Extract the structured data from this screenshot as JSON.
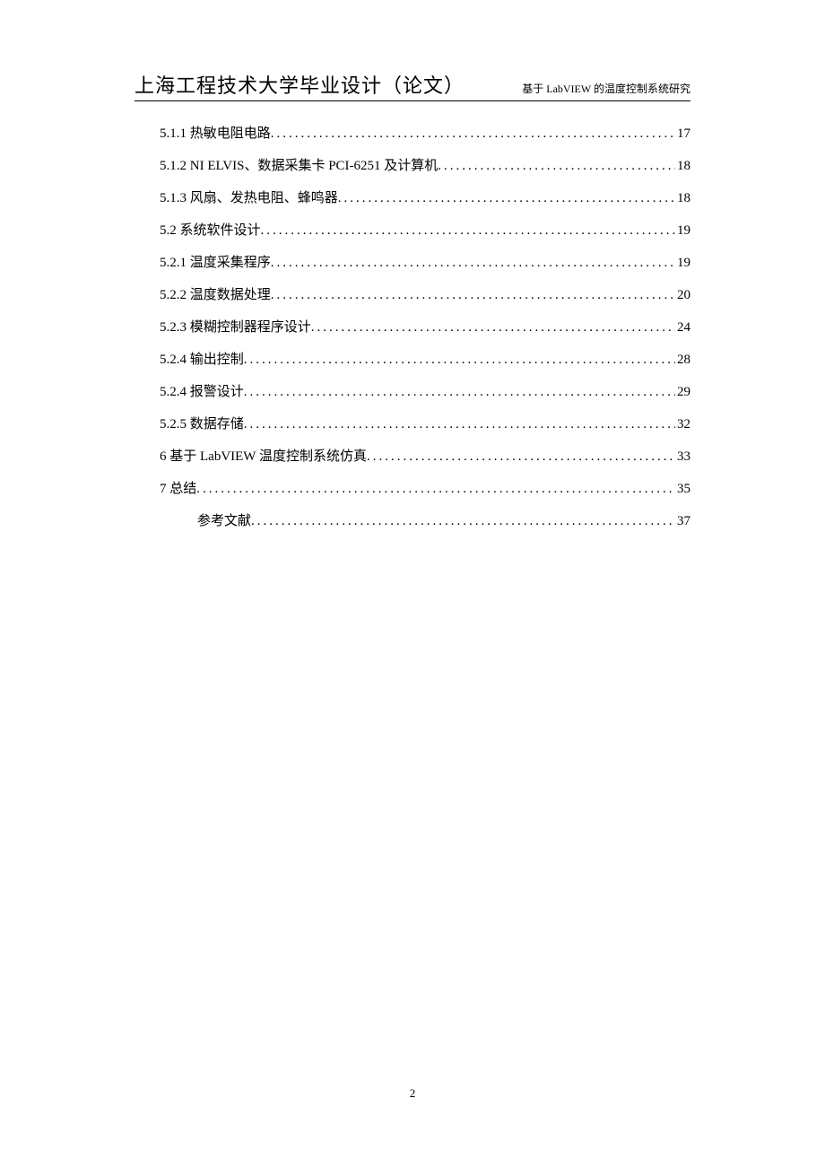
{
  "header": {
    "title": "上海工程技术大学毕业设计（论文）",
    "subtitle": "基于 LabVIEW 的温度控制系统研究"
  },
  "toc": [
    {
      "label": "5.1.1 热敏电阻电路",
      "page": "17",
      "indent": false
    },
    {
      "label": "5.1.2 NI ELVIS、数据采集卡 PCI-6251 及计算机",
      "page": "18",
      "indent": false
    },
    {
      "label": "5.1.3 风扇、发热电阻、蜂鸣器",
      "page": "18",
      "indent": false
    },
    {
      "label": "5.2 系统软件设计",
      "page": "19",
      "indent": false
    },
    {
      "label": "5.2.1 温度采集程序",
      "page": "19",
      "indent": false
    },
    {
      "label": "5.2.2 温度数据处理",
      "page": "20",
      "indent": false
    },
    {
      "label": "5.2.3 模糊控制器程序设计",
      "page": "24",
      "indent": false
    },
    {
      "label": "5.2.4 输出控制",
      "page": "28",
      "indent": false
    },
    {
      "label": "5.2.4 报警设计",
      "page": "29",
      "indent": false
    },
    {
      "label": "5.2.5 数据存储",
      "page": "32",
      "indent": false
    },
    {
      "label": "6 基于 LabVIEW 温度控制系统仿真",
      "page": "33",
      "indent": false
    },
    {
      "label": "7 总结",
      "page": "35",
      "indent": false
    },
    {
      "label": "参考文献 ",
      "page": "37",
      "indent": true
    }
  ],
  "page_number": "2"
}
